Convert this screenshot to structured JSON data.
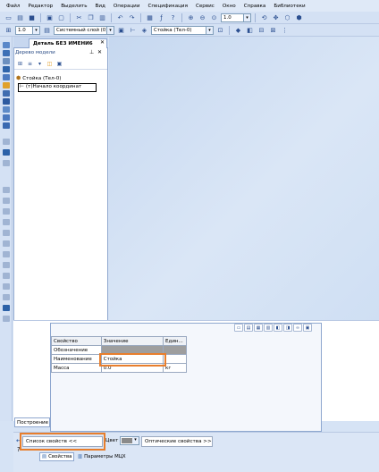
{
  "menu": [
    "Файл",
    "Редактор",
    "Выделить",
    "Вид",
    "Операции",
    "Спецификация",
    "Сервис",
    "Окно",
    "Справка",
    "Библиотеки"
  ],
  "toolbar": {
    "zoom_value": "1.0",
    "scale_value": "1.0",
    "layer_value": "Системный слой (0)",
    "part_value": "Стойка (Тел-0)"
  },
  "model_panel": {
    "tab_label": "Деталь БЕЗ ИМЕНИ6",
    "tree_title": "Дерево модели",
    "root_item": "Стойка (Тел-0)",
    "child_item": "(т)Начало координат"
  },
  "properties": {
    "headers": [
      "Свойство",
      "Значение",
      "Един..."
    ],
    "rows": [
      {
        "name": "Обозначение",
        "value": "",
        "unit": ""
      },
      {
        "name": "Наименование",
        "value": "Стойка",
        "unit": ""
      },
      {
        "name": "Масса",
        "value": "0.0",
        "unit": "кг"
      }
    ]
  },
  "bottom": {
    "build_tab": "Построение",
    "list_button": "Список свойств  <<",
    "color_label": "Цвет",
    "optic_button": "Оптические свойства  >>",
    "tab_properties": "Свойства",
    "tab_mcx": "Параметры МЦХ"
  },
  "colors": {
    "highlight": "#e87e2c",
    "selected_cell": "#9e9e9e"
  }
}
